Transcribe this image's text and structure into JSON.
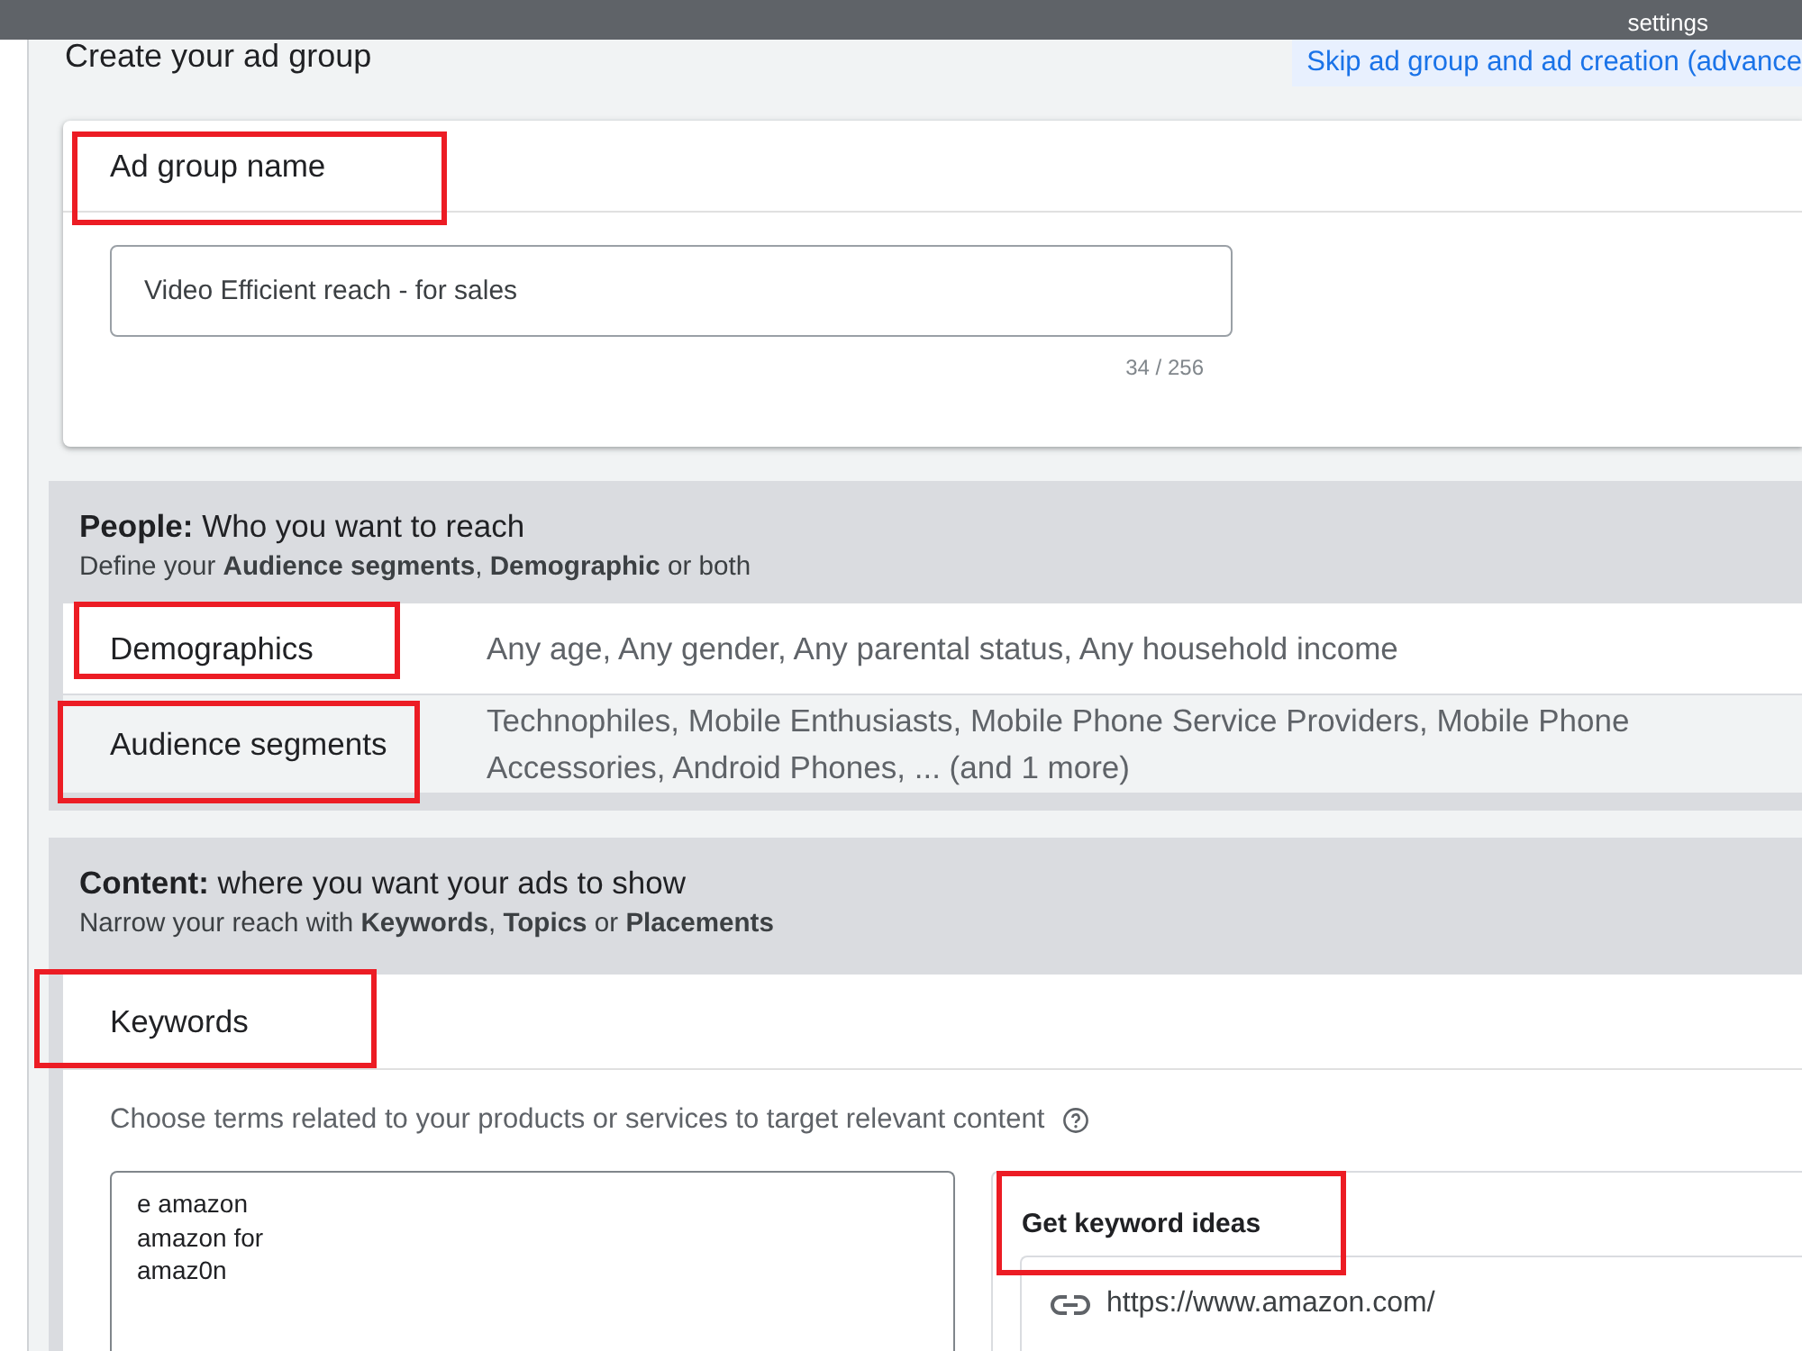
{
  "top_bar": {
    "nav_items": [
      {
        "label": "settings"
      }
    ]
  },
  "header": {
    "title": "Create your ad group",
    "skip_link": "Skip ad group and ad creation (advance"
  },
  "ad_group_card": {
    "title": "Ad group name",
    "highlighted": true,
    "name_field": {
      "value": "Video Efficient reach - for sales",
      "counter": "34 / 256"
    }
  },
  "people_section": {
    "title": "**People:** Who you want to reach",
    "subtitle": "Define your **Audience segments**, **Demographic** or both",
    "rows": [
      {
        "label": "Demographics",
        "summary": "Any age, Any gender, Any parental status, Any household income",
        "hovered": false,
        "highlighted": true
      },
      {
        "label": "Audience segments",
        "summary": "Technophiles, Mobile Enthusiasts, Mobile Phone Service Providers, Mobile Phone Accessories, Android Phones, ... (and 1 more)",
        "hovered": true,
        "highlighted": true
      }
    ]
  },
  "content_section": {
    "title": "**Content:** where you want your ads to show",
    "subtitle": "Narrow your reach with **Keywords**, **Topics** or **Placements**",
    "keywords_card": {
      "title": "Keywords",
      "highlighted": true,
      "hint": "Choose terms related to your products or services to target relevant content",
      "keywords_field": {
        "value": "e amazon\namazon for\namaz0n"
      },
      "keyword_ideas": {
        "title": "Get keyword ideas",
        "highlighted": true,
        "url_field": {
          "value": "https://www.amazon.com/"
        }
      }
    }
  }
}
